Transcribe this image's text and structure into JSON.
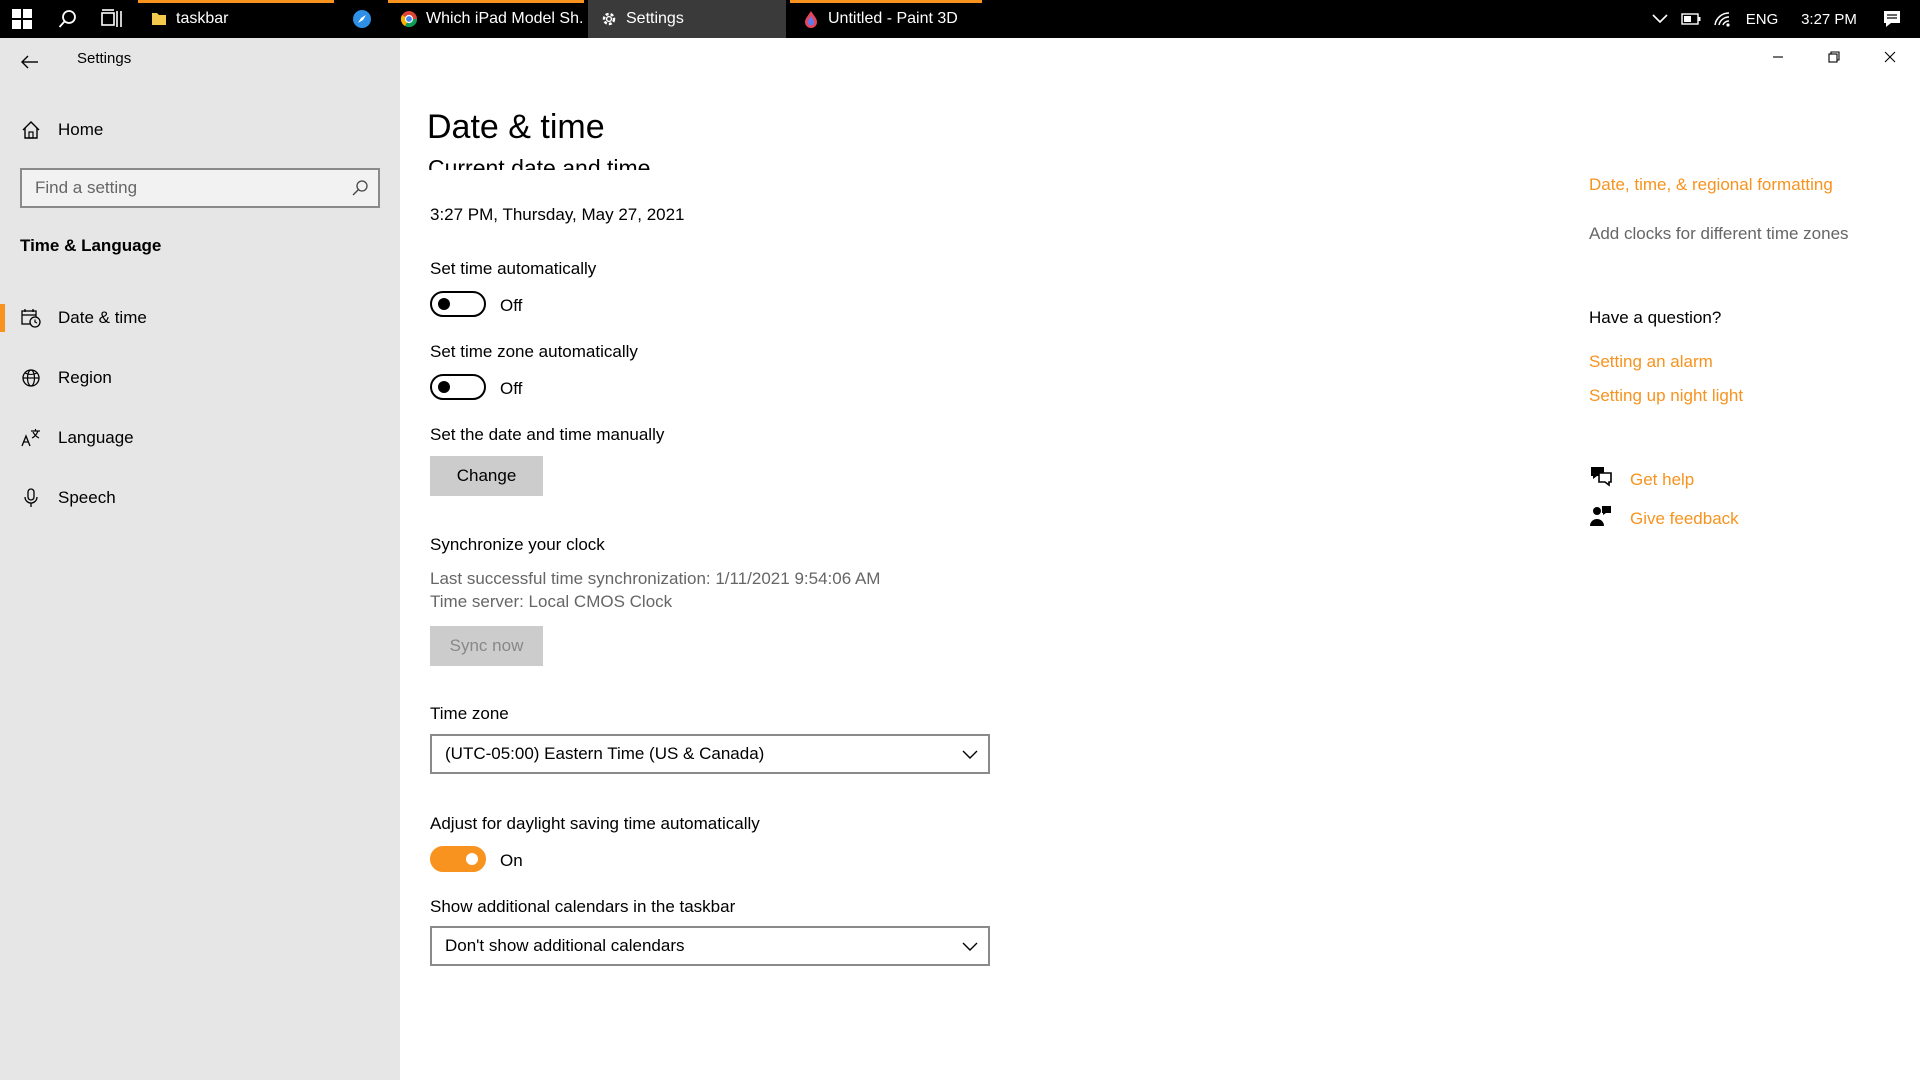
{
  "taskbar": {
    "tasks": [
      {
        "label": "taskbar",
        "accent": "#f7931e"
      },
      {
        "label": "Which iPad Model Sh...",
        "accent": "#f7931e"
      },
      {
        "label": "Settings",
        "accent": "#3a3a3a"
      },
      {
        "label": "Untitled - Paint 3D",
        "accent": "#f7931e"
      }
    ],
    "language": "ENG",
    "time": "3:27 PM"
  },
  "sidebar": {
    "app_title": "Settings",
    "home_label": "Home",
    "search_placeholder": "Find a setting",
    "section_heading": "Time & Language",
    "items": [
      {
        "label": "Date & time",
        "icon": "calendar-clock-icon",
        "selected": true
      },
      {
        "label": "Region",
        "icon": "globe-icon",
        "selected": false
      },
      {
        "label": "Language",
        "icon": "language-icon",
        "selected": false
      },
      {
        "label": "Speech",
        "icon": "microphone-icon",
        "selected": false
      }
    ]
  },
  "main": {
    "title": "Date & time",
    "subtitle": "Current date and time",
    "current_datetime": "3:27 PM, Thursday, May 27, 2021",
    "set_time_auto": {
      "label": "Set time automatically",
      "state": "Off",
      "on": false
    },
    "set_tz_auto": {
      "label": "Set time zone automatically",
      "state": "Off",
      "on": false
    },
    "manual": {
      "label": "Set the date and time manually",
      "button": "Change"
    },
    "sync": {
      "heading": "Synchronize your clock",
      "last": "Last successful time synchronization: 1/11/2021 9:54:06 AM",
      "server": "Time server: Local CMOS Clock",
      "button": "Sync now"
    },
    "timezone": {
      "label": "Time zone",
      "value": "(UTC-05:00) Eastern Time (US & Canada)"
    },
    "dst": {
      "label": "Adjust for daylight saving time automatically",
      "state": "On",
      "on": true
    },
    "calendars": {
      "label": "Show additional calendars in the taskbar",
      "value": "Don't show additional calendars"
    }
  },
  "rail": {
    "formatting_link": "Date, time, & regional formatting",
    "clocks_text": "Add clocks for different time zones",
    "question_heading": "Have a question?",
    "links": [
      "Setting an alarm",
      "Setting up night light"
    ],
    "get_help": "Get help",
    "give_feedback": "Give feedback"
  },
  "colors": {
    "accent": "#f7931e",
    "sidebar_bg": "#e6e6e6",
    "taskbar_bg": "#000000"
  }
}
